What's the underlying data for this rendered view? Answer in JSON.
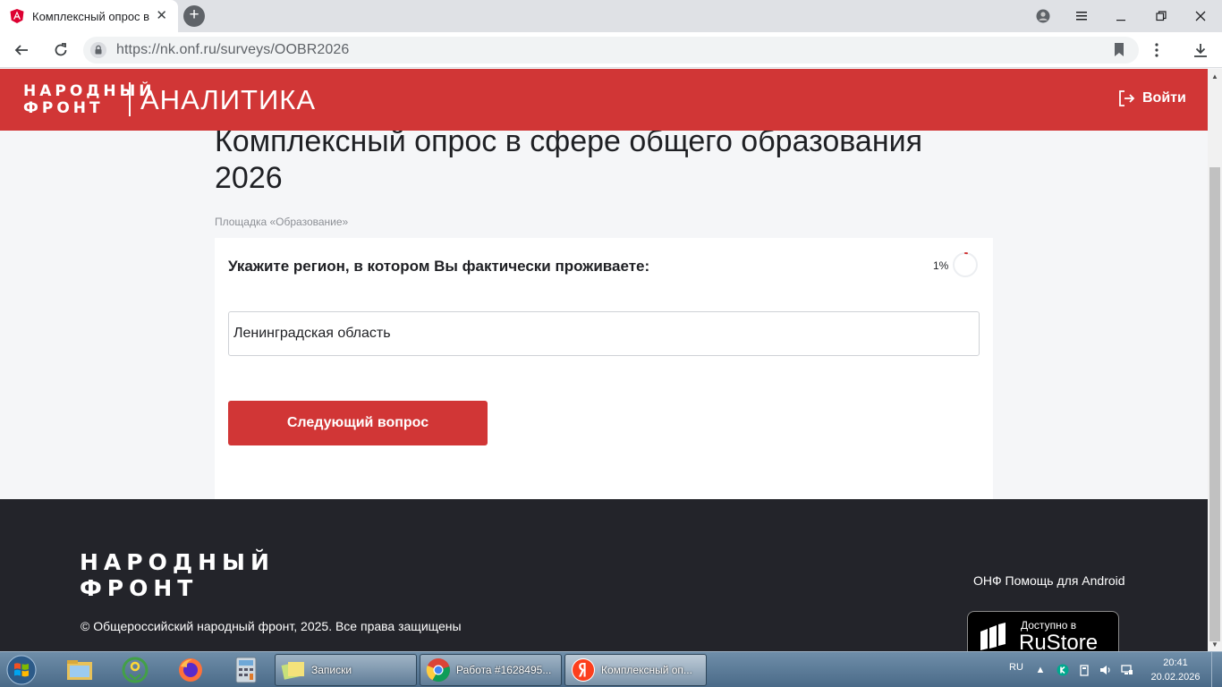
{
  "browser": {
    "tab_title": "Комплексный опрос в сфере",
    "tab_close": "✕",
    "new_tab": "+",
    "url": "https://nk.onf.ru/surveys/OOBR2026"
  },
  "site_header": {
    "logo_text": "НАРОДНЫЙ\nФРОНТ",
    "section_title": "АНАЛИТИКА",
    "login_label": "Войти"
  },
  "survey": {
    "title": "Комплексный опрос в сфере общего образования 2026",
    "platform": "Площадка «Образование»",
    "question": "Укажите регион, в котором Вы фактически проживаете:",
    "progress_label": "1%",
    "progress_value": 0.01,
    "answer_value": "Ленинградская область",
    "next_button": "Следующий вопрос"
  },
  "footer": {
    "logo_text": "НАРОДНЫЙ\nФРОНТ",
    "copyright": "© Общероссийский народный фронт, 2025. Все права защищены",
    "android_label": "ОНФ Помощь для Android",
    "rustore_small": "Доступно в",
    "rustore_big": "RuStore"
  },
  "taskbar": {
    "tasks": [
      {
        "label": "Записки"
      },
      {
        "label": "Работа #1628495..."
      },
      {
        "label": "Комплексный оп..."
      }
    ],
    "language": "RU",
    "time": "20:41",
    "date": "20.02.2026"
  },
  "colors": {
    "brand_red": "#d13636",
    "footer_bg": "#23242a",
    "page_bg": "#f5f6f8"
  }
}
